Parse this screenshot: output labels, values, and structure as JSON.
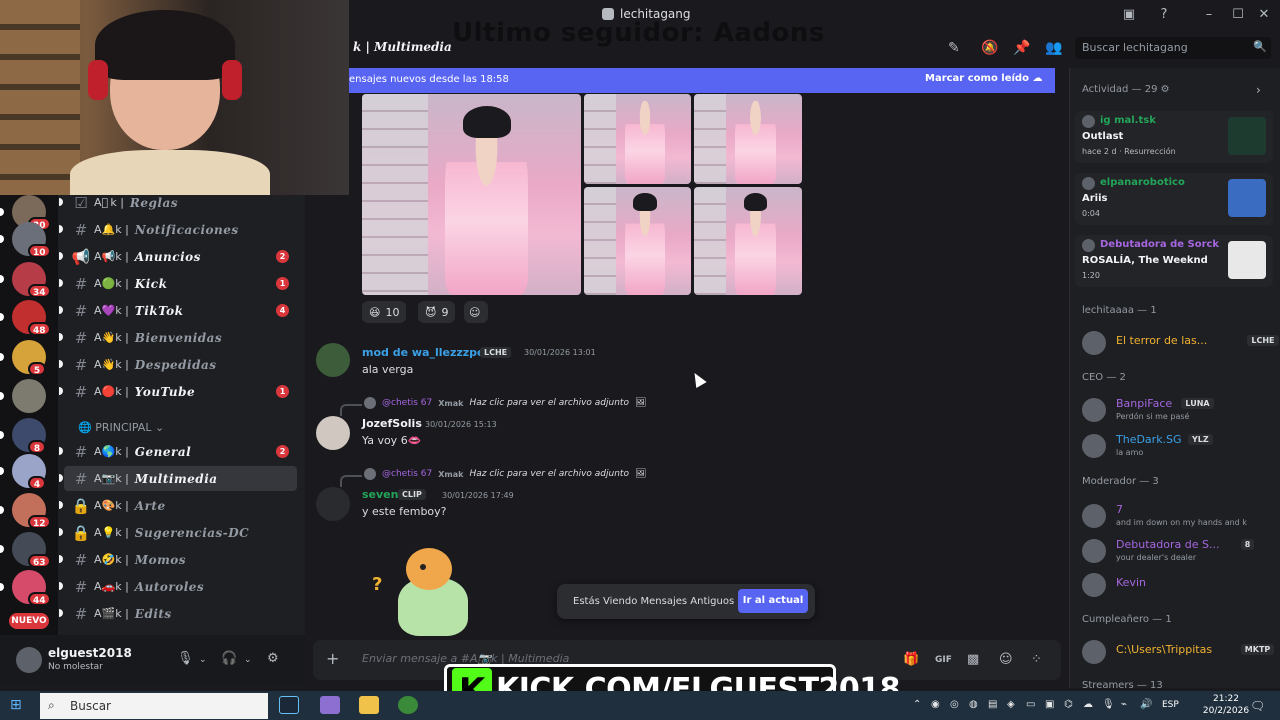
{
  "window": {
    "server_title": "lechitagang",
    "overlay_follower": "Ultimo seguidor: Aadons"
  },
  "servers": [
    {
      "badge": "30",
      "color": "#7b6a5a"
    },
    {
      "badge": "10",
      "color": "#6b6f7a"
    },
    {
      "badge": "34",
      "color": "#b63c48"
    },
    {
      "badge": "48",
      "color": "#c12f2f"
    },
    {
      "badge": "5",
      "color": "#d6a23a"
    },
    {
      "badge": "",
      "color": "#7d7a70"
    },
    {
      "badge": "8",
      "color": "#3d4a6b"
    },
    {
      "badge": "4",
      "color": "#9aa4c8"
    },
    {
      "badge": "12",
      "color": "#c26f5b"
    },
    {
      "badge": "63",
      "color": "#444a56"
    },
    {
      "badge": "44",
      "color": "#d64b6a"
    }
  ],
  "new_label": "NUEVO",
  "channels": [
    {
      "icon": "☑",
      "emoji": "A🏻 k |",
      "name": "Reglas",
      "badge": ""
    },
    {
      "icon": "#",
      "emoji": "A🔔k |",
      "name": "Notificaciones",
      "badge": ""
    },
    {
      "icon": "📢",
      "emoji": "A📢k |",
      "name": "Anuncios",
      "badge": "2"
    },
    {
      "icon": "#",
      "emoji": "A🟢k |",
      "name": "Kick",
      "badge": "1"
    },
    {
      "icon": "#",
      "emoji": "A💜k |",
      "name": "TikTok",
      "badge": "4"
    },
    {
      "icon": "#",
      "emoji": "A👋k |",
      "name": "Bienvenidas",
      "badge": ""
    },
    {
      "icon": "#",
      "emoji": "A👋k |",
      "name": "Despedidas",
      "badge": ""
    },
    {
      "icon": "#",
      "emoji": "A🔴k |",
      "name": "YouTube",
      "badge": "1"
    }
  ],
  "category": "PRINCIPAL",
  "channels2": [
    {
      "icon": "#",
      "emoji": "A🌎k |",
      "name": "General",
      "badge": "2"
    },
    {
      "icon": "#",
      "emoji": "A📷k |",
      "name": "Multimedia",
      "badge": ""
    },
    {
      "icon": "🔒",
      "emoji": "A🎨k |",
      "name": "Arte",
      "badge": ""
    },
    {
      "icon": "🔒",
      "emoji": "A💡k |",
      "name": "Sugerencias-DC",
      "badge": ""
    },
    {
      "icon": "#",
      "emoji": "A🤣k |",
      "name": "Momos",
      "badge": ""
    },
    {
      "icon": "#",
      "emoji": "A🚗k |",
      "name": "Autoroles",
      "badge": ""
    },
    {
      "icon": "#",
      "emoji": "A🎬k |",
      "name": "Edits",
      "badge": ""
    }
  ],
  "user": {
    "name": "elguest2018",
    "status": "No molestar"
  },
  "header": {
    "channel_title": "k | Multimedia",
    "search_placeholder": "Buscar lechitagang"
  },
  "newbar": {
    "text": "ensajes nuevos desde las 18:58",
    "mark_read": "Marcar como leído"
  },
  "reactions": [
    {
      "emoji": "😆",
      "count": "10"
    },
    {
      "emoji": "😈",
      "count": "9"
    }
  ],
  "messages": [
    {
      "author": "mod de wa_llezzzpe",
      "tag": "LCHE",
      "time": "30/01/2026 13:01",
      "body": "ala verga",
      "color": "#3ba0e6"
    },
    {
      "reply_name": "@chetis 67",
      "reply_tag": "Xmak",
      "reply_text": "Haz clic para ver el archivo adjunto",
      "author": "JozefSolis",
      "time": "30/01/2026 15:13",
      "body": "Ya voy 6👄",
      "color": "#f2f3f5"
    },
    {
      "reply_name": "@chetis 67",
      "reply_tag": "Xmak",
      "reply_text": "Haz clic para ver el archivo adjunto",
      "author": "seven",
      "tag": "CLIP",
      "time": "30/01/2026 17:49",
      "body": "y este femboy?",
      "color": "#23a559"
    }
  ],
  "toast": {
    "text": "Estás Viendo Mensajes Antiguos",
    "button": "Ir al actual"
  },
  "composer": {
    "placeholder": "Enviar mensaje a #A📷k | Multimedia"
  },
  "members": {
    "activity_header": "Actividad — 29",
    "activities": [
      {
        "name": "ig mal.tsk",
        "title": "Outlast",
        "sub": "hace 2 d  · Resurrección",
        "color": "#23a559"
      },
      {
        "name": "elpanarobotico",
        "title": "Ariis",
        "sub": "0:04",
        "color": "#23a559"
      },
      {
        "name": "Debutadora de Sorck",
        "title": "ROSALÍA, The Weeknd",
        "sub": "1:20",
        "color": "#a566e0"
      }
    ],
    "groups": [
      {
        "header": "lechitaaaa — 1",
        "members": [
          {
            "name": "El terror de las...",
            "tag": "LCHE",
            "sub": "",
            "color": "#f0b232"
          }
        ]
      },
      {
        "header": "CEO — 2",
        "members": [
          {
            "name": "BanpiFace",
            "tag": "LUNA",
            "sub": "Perdón si me pasé",
            "color": "#a566e0"
          },
          {
            "name": "TheDark.SG",
            "tag": "YLZ",
            "sub": "la amo",
            "color": "#3ba0e6"
          }
        ]
      },
      {
        "header": "Moderador — 3",
        "members": [
          {
            "name": "7",
            "tag": "",
            "sub": "and im down on my hands and k",
            "color": "#a566e0"
          },
          {
            "name": "Debutadora de S...",
            "tag": "8",
            "sub": "your dealer's dealer",
            "color": "#a566e0"
          },
          {
            "name": "Kevin",
            "tag": "",
            "sub": "",
            "color": "#a566e0"
          }
        ]
      },
      {
        "header": "Cumpleañero — 1",
        "members": [
          {
            "name": "C:\\Users\\Trippitas",
            "tag": "MKTP",
            "sub": "",
            "color": "#f0b232"
          }
        ]
      },
      {
        "header": "Streamers — 13",
        "members": []
      }
    ]
  },
  "kick_banner": {
    "k": "K",
    "text": "KICK.COM/ELGUEST2018"
  },
  "taskbar": {
    "search": "Buscar",
    "lang": "ESP",
    "time": "21:22",
    "date": "20/2/2026"
  }
}
